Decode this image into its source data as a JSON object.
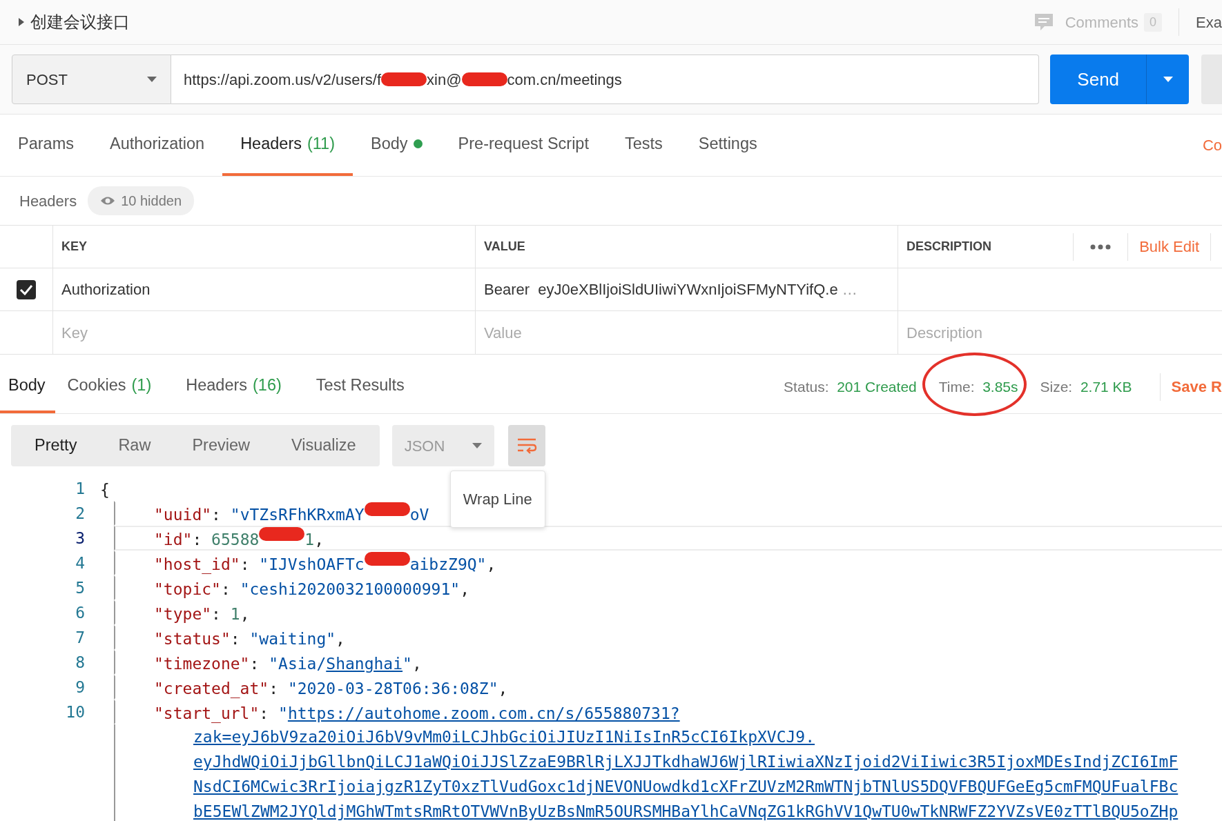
{
  "request": {
    "title": "创建会议接口",
    "comments_label": "Comments",
    "comments_count": "0",
    "examples_label": "Exa",
    "method": "POST",
    "url": [
      {
        "kind": "text",
        "text": "https://api.zoom.us/v2/users/f"
      },
      {
        "kind": "redaction"
      },
      {
        "kind": "text",
        "text": "xin@"
      },
      {
        "kind": "redaction"
      },
      {
        "kind": "text",
        "text": "com.cn/meetings"
      }
    ],
    "send_label": "Send"
  },
  "request_tabs": [
    {
      "label": "Params",
      "dot": false,
      "selected": false
    },
    {
      "label": "Authorization",
      "dot": false,
      "selected": false
    },
    {
      "label": "Headers",
      "count": "(11)",
      "dot": false,
      "selected": true
    },
    {
      "label": "Body",
      "dot": true,
      "selected": false
    },
    {
      "label": "Pre-request Script",
      "dot": false,
      "selected": false
    },
    {
      "label": "Tests",
      "dot": false,
      "selected": false
    },
    {
      "label": "Settings",
      "dot": false,
      "selected": false
    }
  ],
  "cookies_cut": "Co",
  "headers_bar": {
    "title": "Headers",
    "hidden_label": "10 hidden"
  },
  "headers_table": {
    "columns": [
      "KEY",
      "VALUE",
      "DESCRIPTION"
    ],
    "bulk_edit": "Bulk Edit",
    "rows": [
      {
        "checked": true,
        "key": "Authorization",
        "value": "Bearer  eyJ0eXBlIjoiSldUIiwiYWxnIjoiSFMyNTYifQ.e",
        "truncation": "…"
      }
    ],
    "new_row": {
      "key_placeholder": "Key",
      "value_placeholder": "Value",
      "description_placeholder": "Description"
    }
  },
  "response": {
    "tabs": [
      {
        "label": "Body",
        "selected": true
      },
      {
        "label": "Cookies",
        "count": "(1)",
        "selected": false
      },
      {
        "label": "Headers",
        "count": "(16)",
        "selected": false
      },
      {
        "label": "Test Results",
        "selected": false
      }
    ],
    "stats": [
      {
        "label": "Status:",
        "value": "201 Created",
        "circled": false
      },
      {
        "label": "Time:",
        "value": "3.85s",
        "circled": true
      },
      {
        "label": "Size:",
        "value": "2.71 KB",
        "circled": false
      }
    ],
    "save_label": "Save R",
    "view_modes": [
      {
        "label": "Pretty",
        "selected": true
      },
      {
        "label": "Raw",
        "selected": false
      },
      {
        "label": "Preview",
        "selected": false
      },
      {
        "label": "Visualize",
        "selected": false
      }
    ],
    "format": "JSON",
    "wrap_active": true,
    "tooltip": "Wrap Line",
    "code_lines": [
      {
        "number": "1",
        "current": false,
        "segments": [
          {
            "kind": "punct",
            "text": "{"
          }
        ]
      },
      {
        "number": "2",
        "current": false,
        "segments": [
          {
            "kind": "key",
            "text": "\"uuid\""
          },
          {
            "kind": "punct",
            "text": ": "
          },
          {
            "kind": "string",
            "text": "\"vTZsRFhKRxmAY"
          },
          {
            "kind": "redaction"
          },
          {
            "kind": "string",
            "text": "oV"
          }
        ]
      },
      {
        "number": "3",
        "current": true,
        "segments": [
          {
            "kind": "key",
            "text": "\"id\""
          },
          {
            "kind": "punct",
            "text": ": "
          },
          {
            "kind": "number",
            "text": "65588"
          },
          {
            "kind": "redaction"
          },
          {
            "kind": "number",
            "text": "1"
          },
          {
            "kind": "punct",
            "text": ","
          }
        ]
      },
      {
        "number": "4",
        "current": false,
        "segments": [
          {
            "kind": "key",
            "text": "\"host_id\""
          },
          {
            "kind": "punct",
            "text": ": "
          },
          {
            "kind": "string",
            "text": "\"IJVshOAFTc"
          },
          {
            "kind": "redaction"
          },
          {
            "kind": "string",
            "text": "aibzZ9Q\""
          },
          {
            "kind": "punct",
            "text": ","
          }
        ]
      },
      {
        "number": "5",
        "current": false,
        "segments": [
          {
            "kind": "key",
            "text": "\"topic\""
          },
          {
            "kind": "punct",
            "text": ": "
          },
          {
            "kind": "string",
            "text": "\"ceshi2020032100000991\""
          },
          {
            "kind": "punct",
            "text": ","
          }
        ]
      },
      {
        "number": "6",
        "current": false,
        "segments": [
          {
            "kind": "key",
            "text": "\"type\""
          },
          {
            "kind": "punct",
            "text": ": "
          },
          {
            "kind": "number",
            "text": "1"
          },
          {
            "kind": "punct",
            "text": ","
          }
        ]
      },
      {
        "number": "7",
        "current": false,
        "segments": [
          {
            "kind": "key",
            "text": "\"status\""
          },
          {
            "kind": "punct",
            "text": ": "
          },
          {
            "kind": "string",
            "text": "\"waiting\""
          },
          {
            "kind": "punct",
            "text": ","
          }
        ]
      },
      {
        "number": "8",
        "current": false,
        "segments": [
          {
            "kind": "key",
            "text": "\"timezone\""
          },
          {
            "kind": "punct",
            "text": ": "
          },
          {
            "kind": "string",
            "text": "\"Asia/"
          },
          {
            "kind": "link",
            "text": "Shanghai"
          },
          {
            "kind": "string",
            "text": "\""
          },
          {
            "kind": "punct",
            "text": ","
          }
        ]
      },
      {
        "number": "9",
        "current": false,
        "segments": [
          {
            "kind": "key",
            "text": "\"created_at\""
          },
          {
            "kind": "punct",
            "text": ": "
          },
          {
            "kind": "string",
            "text": "\"2020-03-28T06:36:08Z\""
          },
          {
            "kind": "punct",
            "text": ","
          }
        ]
      },
      {
        "number": "10",
        "current": false,
        "segments": [
          {
            "kind": "key",
            "text": "\"start_url\""
          },
          {
            "kind": "punct",
            "text": ": "
          },
          {
            "kind": "string",
            "text": "\""
          },
          {
            "kind": "link",
            "text": "https://autohome.zoom.com.cn/s/655880731?"
          }
        ],
        "wrapped": [
          "zak=eyJ6bV9za20iOiJ6bV9vMm0iLCJhbGciOiJIUzI1NiIsInR5cCI6IkpXVCJ9.",
          "eyJhdWQiOiJjbGllbnQiLCJ1aWQiOiJJSlZzaE9BRlRjLXJJTkdhaWJ6WjlRIiwiaXNzIjoid2ViIiwic3R5IjoxMDEsIndjZCI6ImF",
          "NsdCI6MCwic3RrIjoiajgzR1ZyT0xzTlVudGoxc1djNEVONUowdkd1cXFrZUVzM2RmWTNjbTNlUS5DQVFBQUFGeEg5cmFMQUFualFBc",
          "bE5EWlZWM2JYQldjMGhWTmtsRmRtOTVWVnByUzBsNmR5OURSMHBaYlhCaVNqZG1kRGhVV1QwTU0wTkNRWFZ2YVZsVE0zTTlBQU5oZHp"
        ]
      }
    ]
  }
}
